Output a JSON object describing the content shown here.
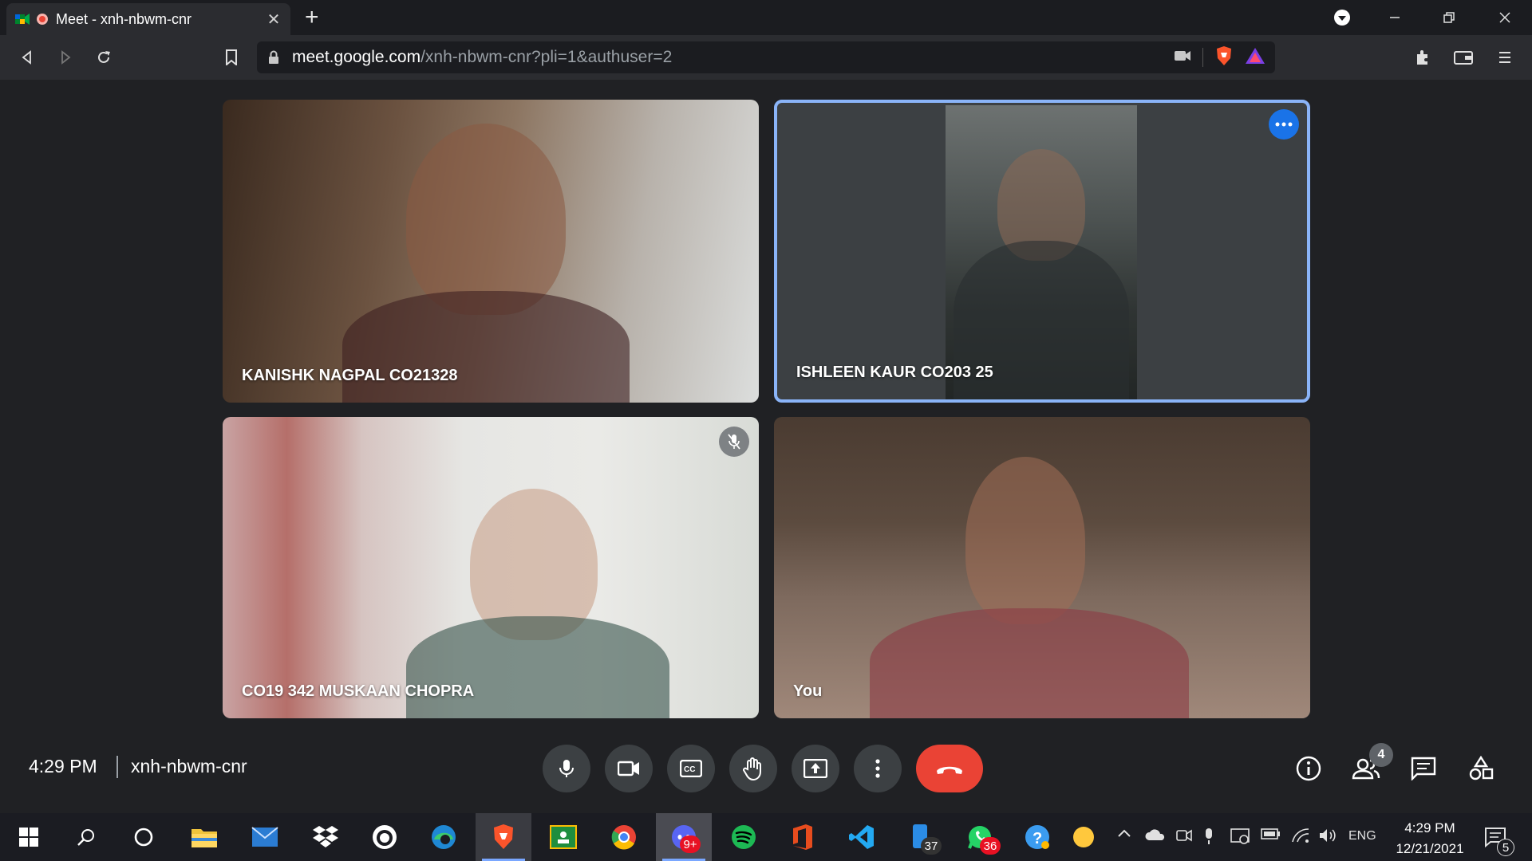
{
  "browser": {
    "tab_title": "Meet - xnh-nbwm-cnr",
    "url_host": "meet.google.com",
    "url_path": "/xnh-nbwm-cnr?pli=1&authuser=2"
  },
  "participants": [
    {
      "name": "KANISHK NAGPAL CO21328",
      "muted": false,
      "speaking": false
    },
    {
      "name": "ISHLEEN KAUR CO203 25",
      "muted": false,
      "speaking": true
    },
    {
      "name": "CO19 342 MUSKAAN CHOPRA",
      "muted": true,
      "speaking": false
    },
    {
      "name": "You",
      "muted": false,
      "speaking": false
    }
  ],
  "meetbar": {
    "time": "4:29 PM",
    "meeting_code": "xnh-nbwm-cnr",
    "people_count": "4",
    "controls": [
      "mic-icon",
      "camera-icon",
      "captions-icon",
      "raise-hand-icon",
      "present-icon",
      "more-options-icon",
      "end-call-icon"
    ],
    "end_call_color": "#ea4335"
  },
  "taskbar": {
    "phone_badge": "37",
    "whatsapp_badge": "36",
    "discord_badge": "9+",
    "language": "ENG",
    "time": "4:29 PM",
    "date": "12/21/2021",
    "notification_count": "5"
  },
  "colors": {
    "accent": "#8ab4f8",
    "meet_bg": "#202124",
    "button_bg": "#3c4043"
  }
}
